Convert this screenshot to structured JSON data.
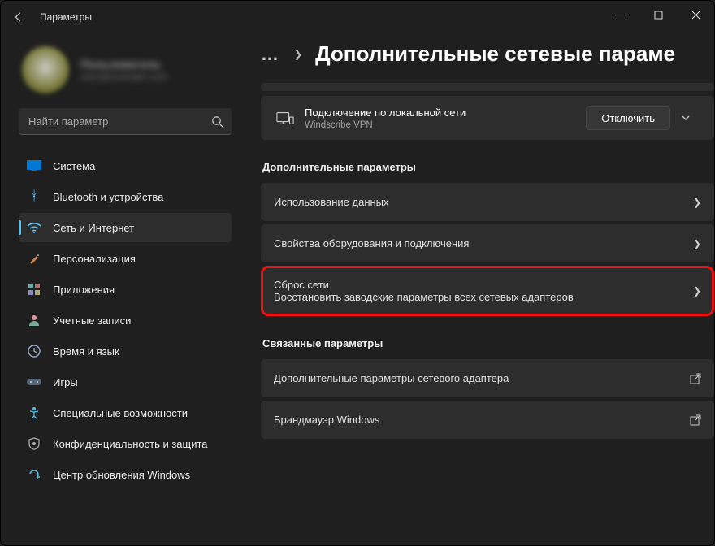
{
  "window": {
    "title": "Параметры"
  },
  "profile": {
    "name": "Пользователь",
    "email": "user@example.com"
  },
  "search": {
    "placeholder": "Найти параметр"
  },
  "nav": [
    {
      "label": "Система",
      "icon": "system"
    },
    {
      "label": "Bluetooth и устройства",
      "icon": "bluetooth"
    },
    {
      "label": "Сеть и Интернет",
      "icon": "wifi",
      "active": true
    },
    {
      "label": "Персонализация",
      "icon": "brush"
    },
    {
      "label": "Приложения",
      "icon": "apps"
    },
    {
      "label": "Учетные записи",
      "icon": "account"
    },
    {
      "label": "Время и язык",
      "icon": "time"
    },
    {
      "label": "Игры",
      "icon": "games"
    },
    {
      "label": "Специальные возможности",
      "icon": "accessibility"
    },
    {
      "label": "Конфиденциальность и защита",
      "icon": "privacy"
    },
    {
      "label": "Центр обновления Windows",
      "icon": "update"
    }
  ],
  "breadcrumb": {
    "dots": "…",
    "title": "Дополнительные сетевые параме"
  },
  "connection": {
    "title": "Подключение по локальной сети",
    "subtitle": "Windscribe VPN",
    "button": "Отключить"
  },
  "section1": "Дополнительные параметры",
  "rows1": [
    {
      "title": "Использование данных"
    },
    {
      "title": "Свойства оборудования и подключения"
    },
    {
      "title": "Сброс сети",
      "subtitle": "Восстановить заводские параметры всех сетевых адаптеров",
      "highlight": true
    }
  ],
  "section2": "Связанные параметры",
  "rows2": [
    {
      "title": "Дополнительные параметры сетевого адаптера",
      "external": true
    },
    {
      "title": "Брандмауэр Windows",
      "external": true
    }
  ]
}
